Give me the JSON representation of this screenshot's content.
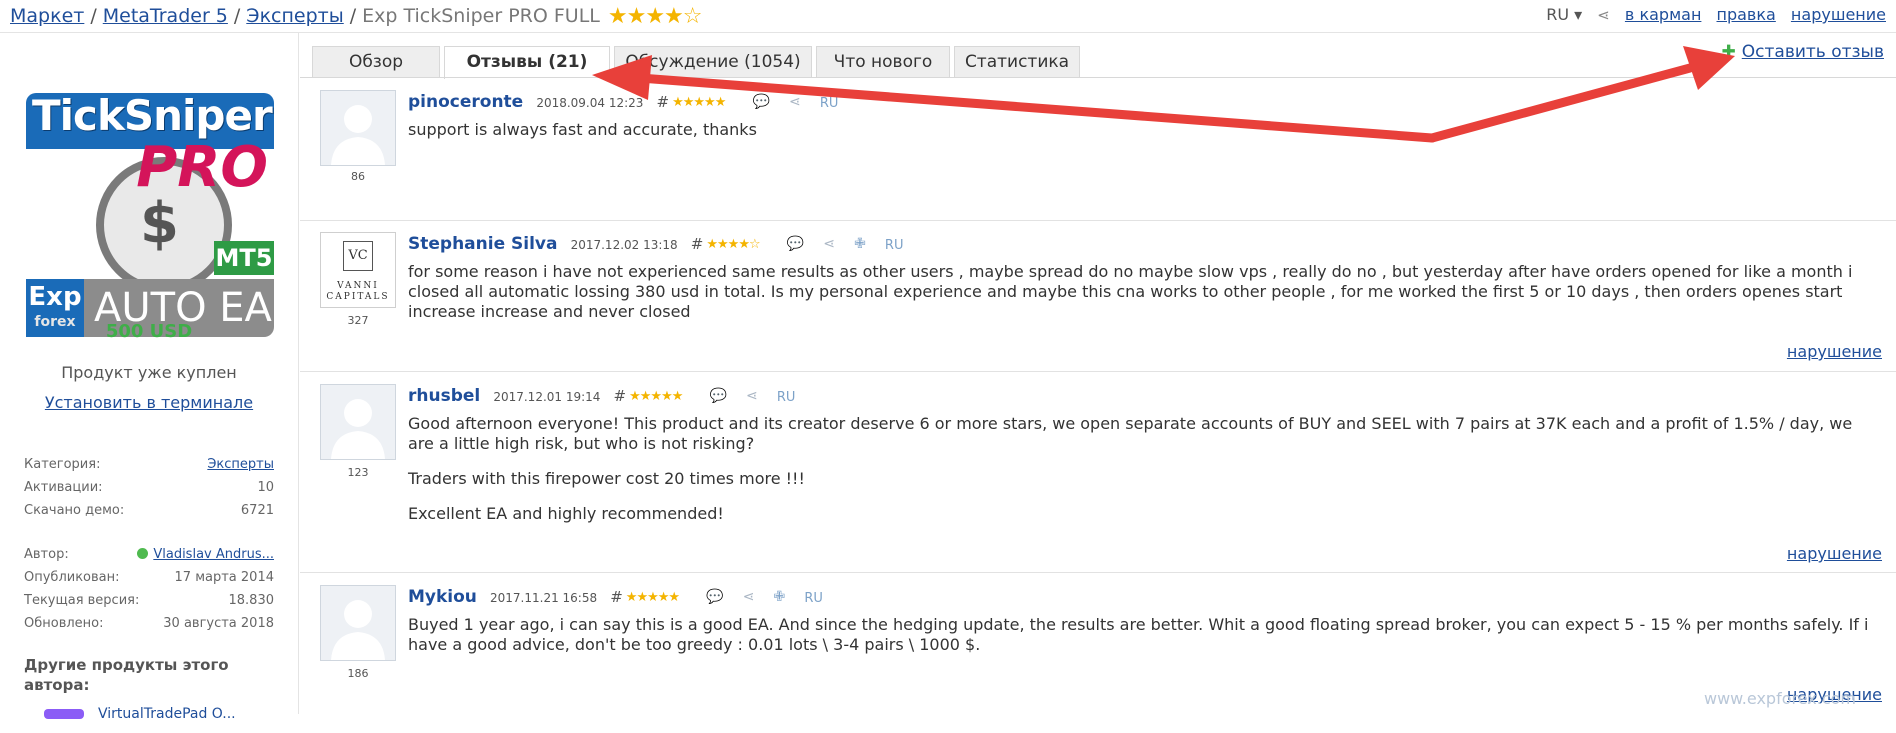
{
  "breadcrumb": {
    "items": [
      "Маркет",
      "MetaTrader 5",
      "Эксперты"
    ],
    "current": "Exp TickSniper PRO FULL",
    "rating_stars": 4.5
  },
  "topbar": {
    "lang": "RU ▾",
    "links": [
      "в карман",
      "правка",
      "нарушение"
    ]
  },
  "sidebar": {
    "product_image": {
      "title": "TickSniper",
      "pro": "PRO",
      "mt5": "MT5",
      "exp": "Exp",
      "forex": "forex",
      "auto": "AUTO EA"
    },
    "price": "500 USD",
    "bought": "Продукт уже куплен",
    "install": "Установить в терминале",
    "meta1": [
      {
        "k": "Категория:",
        "v": "Эксперты",
        "link": true
      },
      {
        "k": "Активации:",
        "v": "10"
      },
      {
        "k": "Скачано демо:",
        "v": "6721"
      }
    ],
    "meta2": [
      {
        "k": "Автор:",
        "v": "Vladislav Andrus...",
        "link": true
      },
      {
        "k": "Опубликован:",
        "v": "17 марта 2014"
      },
      {
        "k": "Текущая версия:",
        "v": "18.830"
      },
      {
        "k": "Обновлено:",
        "v": "30 августа 2018"
      }
    ],
    "others_title": "Другие продукты этого автора:",
    "others_item": "VirtualTradePad O..."
  },
  "tabs": [
    {
      "label": "Обзор",
      "active": false
    },
    {
      "label": "Отзывы (21)",
      "active": true
    },
    {
      "label": "Обсуждение (1054)",
      "active": false
    },
    {
      "label": "Что нового",
      "active": false
    },
    {
      "label": "Статистика",
      "active": false
    }
  ],
  "leave_review": "Оставить отзыв",
  "reviews": [
    {
      "user": "pinoceronte",
      "date": "2018.09.04 12:23",
      "stars": "★★★★★",
      "lang": "RU",
      "rating_num": "86",
      "paragraphs": [
        "support is always fast and accurate, thanks"
      ]
    },
    {
      "user": "Stephanie Silva",
      "date": "2017.12.02 13:18",
      "stars": "★★★★☆",
      "lang": "RU",
      "rating_num": "327",
      "avatar_logo": "VC",
      "avatar_text": "VANNI CAPITALS",
      "paragraphs": [
        "for some reason i have not experienced same results as other users , maybe spread do no maybe slow vps , really do no , but yesterday after have orders opened for like a month i closed all automatic lossing 380 usd in total. Is my personal experience and maybe this cna works to other people , for me worked the first 5 or 10 days , then orders openes start increase increase and never closed"
      ],
      "violation": "нарушение"
    },
    {
      "user": "rhusbel",
      "date": "2017.12.01 19:14",
      "stars": "★★★★★",
      "lang": "RU",
      "rating_num": "123",
      "paragraphs": [
        "Good afternoon everyone! This product and its creator deserve 6 or more stars, we open separate accounts of BUY and SEEL with 7 pairs at 37K each and a profit of 1.5% / day, we are a little high risk, but who is not risking?",
        "Traders with this firepower cost 20 times more !!!",
        "Excellent EA and highly recommended!"
      ],
      "violation": "нарушение"
    },
    {
      "user": "Mykiou",
      "date": "2017.11.21 16:58",
      "stars": "★★★★★",
      "lang": "RU",
      "rating_num": "186",
      "paragraphs": [
        "Buyed 1 year ago, i can say this is a good EA. And since the hedging update, the results are better. Whit a good floating spread broker, you can expect 5 - 15 % per months safely. If i have a good advice, don't be too greedy : 0.01 lots \\ 3-4 pairs \\ 1000 $."
      ],
      "violation": "нарушение"
    }
  ],
  "watermark": "www.expforex.com",
  "colors": {
    "link": "#1f4e9a",
    "price": "#3fae49",
    "arrow": "#e8403a",
    "star": "#f4b400"
  }
}
